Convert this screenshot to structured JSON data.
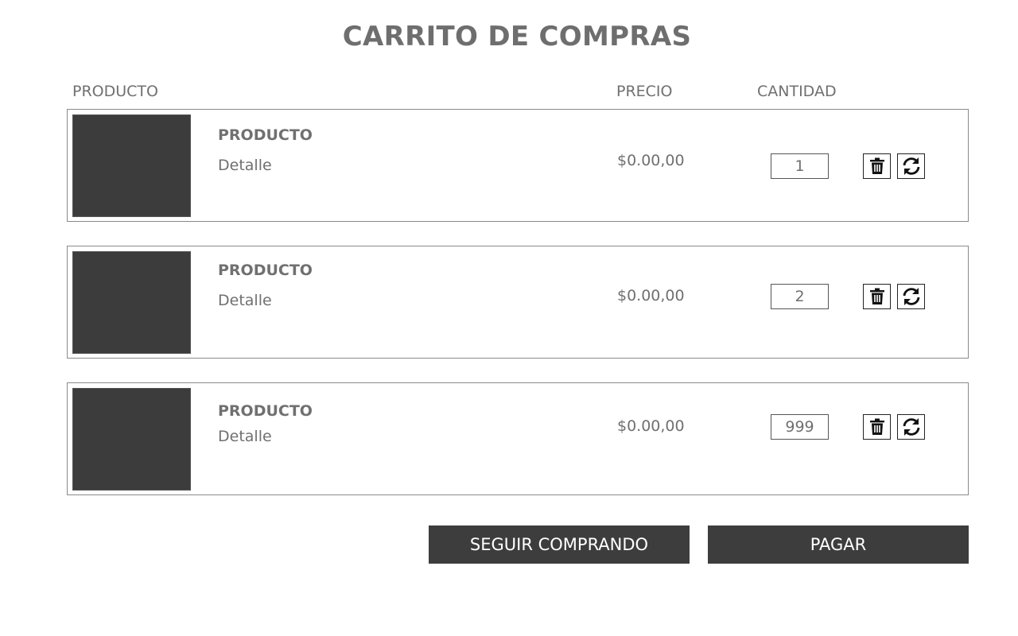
{
  "page": {
    "title": "CARRITO DE COMPRAS"
  },
  "columns": {
    "producto": "PRODUCTO",
    "precio": "PRECIO",
    "cantidad": "CANTIDAD"
  },
  "items": [
    {
      "name": "PRODUCTO",
      "detail": "Detalle",
      "price": "$0.00,00",
      "quantity": "1"
    },
    {
      "name": "PRODUCTO",
      "detail": "Detalle",
      "price": "$0.00,00",
      "quantity": "2"
    },
    {
      "name": "PRODUCTO",
      "detail": "Detalle",
      "price": "$0.00,00",
      "quantity": "999"
    }
  ],
  "actions": {
    "continue_label": "SEGUIR COMPRANDO",
    "pay_label": "PAGAR"
  },
  "icons": {
    "delete": "trash-icon",
    "update": "refresh-icon"
  },
  "colors": {
    "thumbnail": "#3c3c3c",
    "button_bg": "#3d3d3d",
    "text": "#707070"
  }
}
